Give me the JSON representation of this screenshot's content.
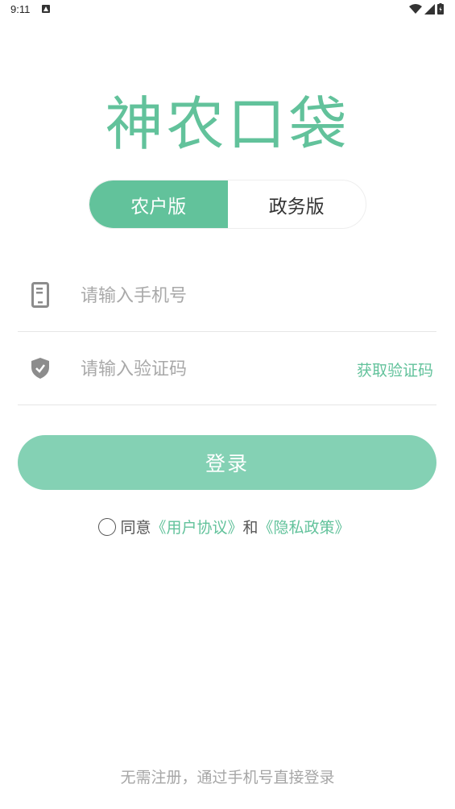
{
  "status_bar": {
    "time": "9:11"
  },
  "logo": {
    "text": "神农口袋"
  },
  "version_tabs": [
    {
      "label": "农户版",
      "active": true
    },
    {
      "label": "政务版",
      "active": false
    }
  ],
  "phone_field": {
    "placeholder": "请输入手机号",
    "value": ""
  },
  "code_field": {
    "placeholder": "请输入验证码",
    "value": "",
    "get_code_label": "获取验证码"
  },
  "login_button": {
    "label": "登录"
  },
  "agreement": {
    "checked": false,
    "prefix": "同意",
    "user_agreement": "《用户协议》",
    "conjunction": "和",
    "privacy_policy": "《隐私政策》"
  },
  "footer": {
    "hint": "无需注册，通过手机号直接登录"
  },
  "colors": {
    "accent": "#62c29b",
    "button": "#84d1b4",
    "placeholder": "#a9a9a9"
  }
}
